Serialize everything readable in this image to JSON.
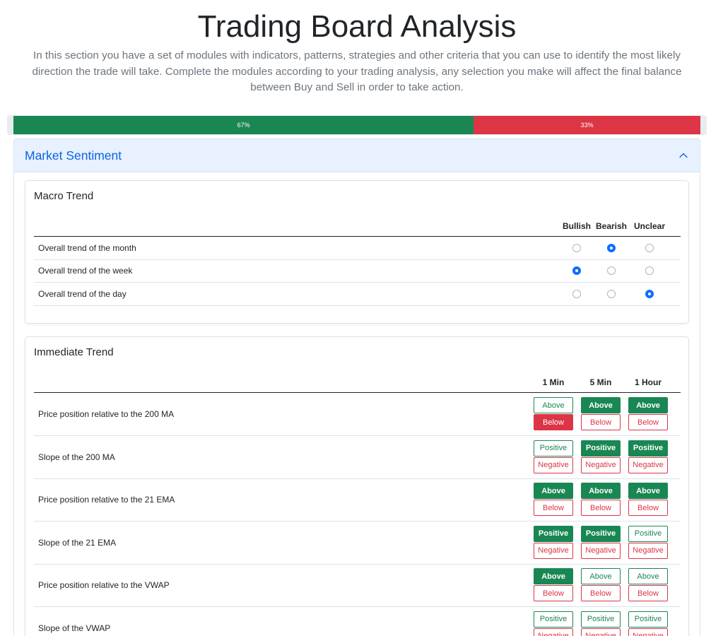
{
  "header": {
    "title": "Trading Board Analysis",
    "description": "In this section you have a set of modules with indicators, patterns, strategies and other criteria that you can use to identify the most likely direction the trade will take. Complete the modules according to your trading analysis, any selection you make will affect the final balance between Buy and Sell in order to take action."
  },
  "balance": {
    "buy_label": "67%",
    "sell_label": "33%",
    "buy_fraction": 0.67,
    "sell_fraction": 0.33,
    "buy_color": "#198754",
    "sell_color": "#dc3545"
  },
  "accordion": {
    "title": "Market Sentiment",
    "expanded": true,
    "icon": "chevron-up-icon"
  },
  "macro": {
    "title": "Macro Trend",
    "columns": [
      "Bullish",
      "Bearish",
      "Unclear"
    ],
    "rows": [
      {
        "label": "Overall trend of the month",
        "selected": "Bearish"
      },
      {
        "label": "Overall trend of the week",
        "selected": "Bullish"
      },
      {
        "label": "Overall trend of the day",
        "selected": "Unclear"
      }
    ]
  },
  "immediate": {
    "title": "Immediate Trend",
    "columns": [
      "1 Min",
      "5 Min",
      "1 Hour"
    ],
    "rows": [
      {
        "label": "Price position relative to the 200 MA",
        "up": "Above",
        "down": "Below",
        "selected": [
          "down",
          "up",
          "up"
        ]
      },
      {
        "label": "Slope of the 200 MA",
        "up": "Positive",
        "down": "Negative",
        "selected": [
          "none",
          "up",
          "up"
        ]
      },
      {
        "label": "Price position relative to the 21 EMA",
        "up": "Above",
        "down": "Below",
        "selected": [
          "up",
          "up",
          "up"
        ]
      },
      {
        "label": "Slope of the 21 EMA",
        "up": "Positive",
        "down": "Negative",
        "selected": [
          "up",
          "up",
          "none"
        ]
      },
      {
        "label": "Price position relative to the VWAP",
        "up": "Above",
        "down": "Below",
        "selected": [
          "up",
          "none",
          "none"
        ]
      },
      {
        "label": "Slope of the VWAP",
        "up": "Positive",
        "down": "Negative",
        "selected": [
          "none",
          "none",
          "none"
        ]
      }
    ]
  }
}
